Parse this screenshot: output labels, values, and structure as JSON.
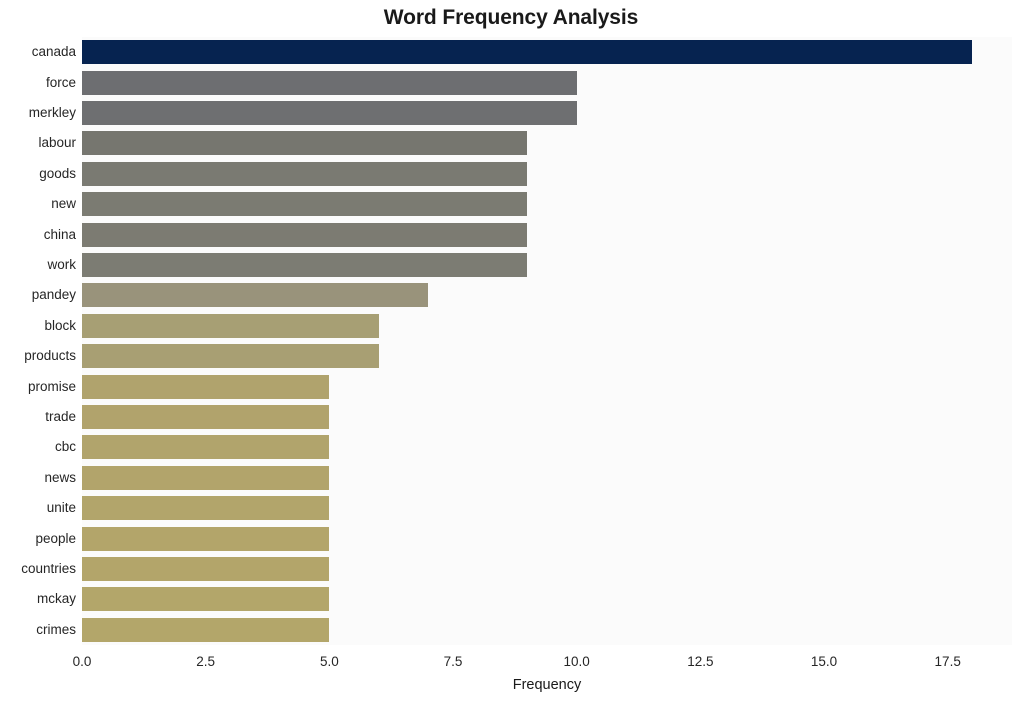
{
  "chart_data": {
    "type": "bar",
    "orientation": "horizontal",
    "title": "Word Frequency Analysis",
    "xlabel": "Frequency",
    "ylabel": "",
    "categories": [
      "canada",
      "force",
      "merkley",
      "labour",
      "goods",
      "new",
      "china",
      "work",
      "pandey",
      "block",
      "products",
      "promise",
      "trade",
      "cbc",
      "news",
      "unite",
      "people",
      "countries",
      "mckay",
      "crimes"
    ],
    "values": [
      18,
      10,
      10,
      9,
      9,
      9,
      9,
      9,
      7,
      6,
      6,
      5,
      5,
      5,
      5,
      5,
      5,
      5,
      5,
      5
    ],
    "bar_colors": [
      "#062350",
      "#6d6e71",
      "#6e6f71",
      "#76766f",
      "#7a7a72",
      "#7b7b72",
      "#7c7b72",
      "#7c7c73",
      "#99937b",
      "#a79f74",
      "#a89f73",
      "#b0a36d",
      "#b1a36c",
      "#b1a46c",
      "#b2a46b",
      "#b2a56b",
      "#b3a56a",
      "#b3a56a",
      "#b3a66a",
      "#b3a66a"
    ],
    "xticks": [
      "0.0",
      "2.5",
      "5.0",
      "7.5",
      "10.0",
      "12.5",
      "15.0",
      "17.5"
    ],
    "xtick_values": [
      0,
      2.5,
      5,
      7.5,
      10,
      12.5,
      15,
      17.5
    ],
    "xlim": [
      0,
      18.8
    ],
    "grid": true,
    "grid_axis": "x",
    "grid_color": "#ffffff",
    "plot_background": "#f5f5f6",
    "figure_background": "#ffffff",
    "legend": null,
    "legend_position": "none"
  }
}
